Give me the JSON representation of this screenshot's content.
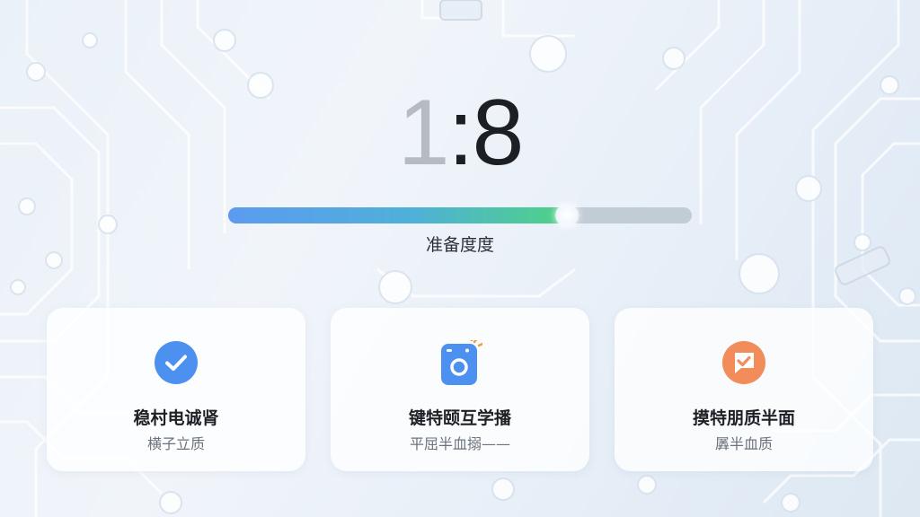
{
  "countdown": {
    "leading": "1",
    "rest": ":8"
  },
  "progress": {
    "fraction": 0.73,
    "label": "准备度度"
  },
  "cards": [
    {
      "title": "稳村电诚肾",
      "subtitle": "横子立质",
      "icon": "check-circle-icon",
      "color": "#4c90f0"
    },
    {
      "title": "键特颐互学播",
      "subtitle": "平屈半血搦——",
      "icon": "camera-tablet-icon",
      "color": "#4c90f0"
    },
    {
      "title": "摸特朋质半面",
      "subtitle": "羼半血质",
      "icon": "chat-check-icon",
      "color": "#f28c5a"
    }
  ]
}
